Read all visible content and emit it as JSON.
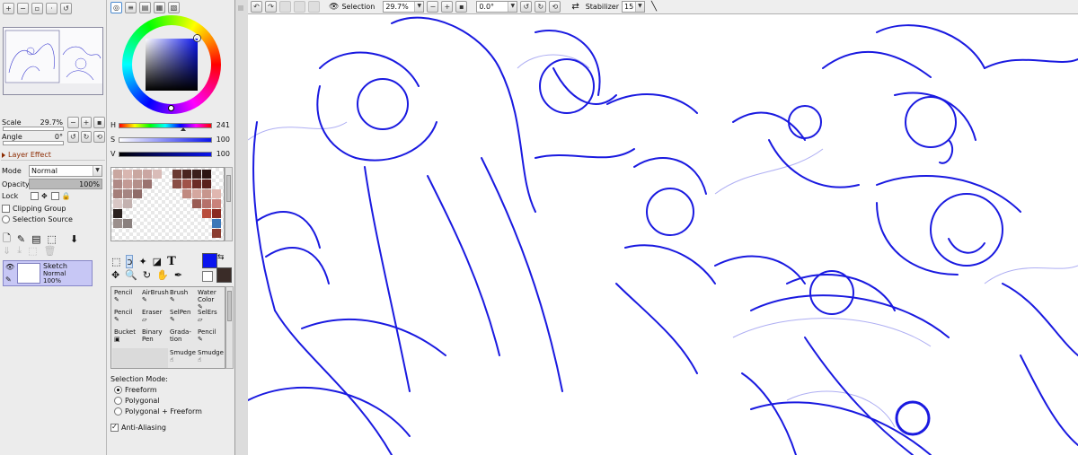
{
  "toolbar": {
    "selection_label": "Selection",
    "zoom_value": "29.7%",
    "angle_value": "0.0°",
    "stabilizer_label": "Stabilizer",
    "stabilizer_value": "15"
  },
  "navigator": {
    "scale_label": "Scale",
    "scale_value": "29.7%",
    "angle_label": "Angle",
    "angle_value": "0°"
  },
  "layer_effect": {
    "header": "Layer Effect",
    "mode_label": "Mode",
    "mode_value": "Normal",
    "opacity_label": "Opacity",
    "opacity_value": "100%",
    "opacity_fraction": 1.0,
    "lock_label": "Lock",
    "clipping_group": "Clipping Group",
    "selection_source": "Selection Source"
  },
  "layers": [
    {
      "name": "Sketch",
      "mode": "Normal",
      "opacity": "100%"
    }
  ],
  "color": {
    "current": "#0a14ee",
    "secondary": "#3a2c28",
    "h_label": "H",
    "h_value": "241",
    "s_label": "S",
    "s_value": "100",
    "v_label": "V",
    "v_value": "100"
  },
  "tools": [
    {
      "label": "Pencil",
      "icon": "pencil-icon"
    },
    {
      "label": "AirBrush",
      "icon": "airbrush-icon"
    },
    {
      "label": "Brush",
      "icon": "brush-icon"
    },
    {
      "label": "Water Color",
      "icon": "watercolor-icon"
    },
    {
      "label": "Pencil",
      "icon": "pencil-icon"
    },
    {
      "label": "Eraser",
      "icon": "eraser-icon"
    },
    {
      "label": "SelPen",
      "icon": "selpen-icon"
    },
    {
      "label": "SelErs",
      "icon": "selers-icon"
    },
    {
      "label": "Bucket",
      "icon": "bucket-icon"
    },
    {
      "label": "Binary Pen",
      "icon": "binary-pen-icon"
    },
    {
      "label": "Grada-tion",
      "icon": "gradation-icon"
    },
    {
      "label": "Pencil",
      "icon": "pencil-icon"
    },
    {
      "label": "",
      "icon": ""
    },
    {
      "label": "",
      "icon": ""
    },
    {
      "label": "Smudge",
      "icon": "smudge-icon"
    },
    {
      "label": "Smudge",
      "icon": "smudge-icon"
    }
  ],
  "selection_mode": {
    "label": "Selection Mode:",
    "options": [
      "Freeform",
      "Polygonal",
      "Polygonal + Freeform"
    ],
    "selected": "Freeform",
    "anti_aliasing": "Anti-Aliasing"
  }
}
